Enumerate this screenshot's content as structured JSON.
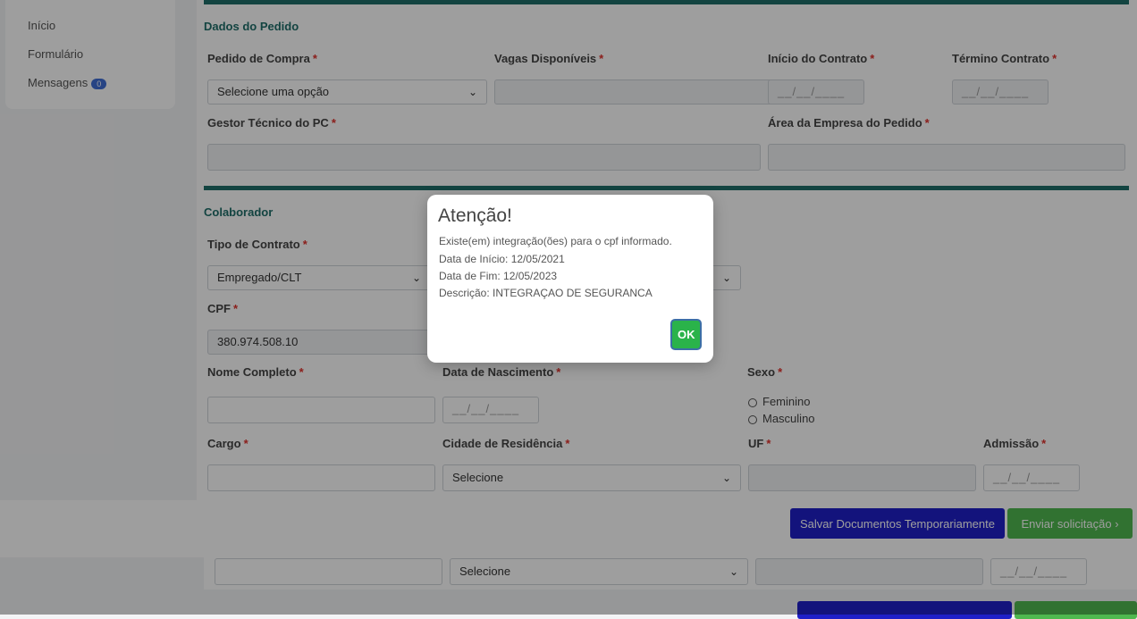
{
  "sidebar": {
    "items": [
      {
        "label": "Início"
      },
      {
        "label": "Formulário"
      },
      {
        "label": "Mensagens",
        "badge": "0"
      }
    ]
  },
  "pedido": {
    "section_title": "Dados do Pedido",
    "pedido_compra": {
      "label": "Pedido de Compra",
      "value": "Selecione uma opção"
    },
    "vagas": {
      "label": "Vagas Disponíveis",
      "value": ""
    },
    "inicio_contrato": {
      "label": "Início do Contrato",
      "placeholder": "__/__/____"
    },
    "termino_contrato": {
      "label": "Término Contrato",
      "placeholder": "__/__/____"
    },
    "gestor": {
      "label": "Gestor Técnico do PC",
      "value": ""
    },
    "area": {
      "label": "Área da Empresa do Pedido",
      "value": ""
    }
  },
  "colaborador": {
    "section_title": "Colaborador",
    "tipo_contrato": {
      "label": "Tipo de Contrato",
      "value": "Empregado/CLT"
    },
    "cpf": {
      "label": "CPF",
      "value": "380.974.508.10"
    },
    "nome": {
      "label": "Nome Completo",
      "value": ""
    },
    "nascimento": {
      "label": "Data de Nascimento",
      "placeholder": "__/__/____"
    },
    "sexo": {
      "label": "Sexo",
      "options": [
        "Feminino",
        "Masculino"
      ]
    },
    "cargo": {
      "label": "Cargo",
      "value": ""
    },
    "cidade": {
      "label": "Cidade de Residência",
      "value": "Selecione"
    },
    "uf": {
      "label": "UF",
      "value": ""
    },
    "admissao": {
      "label": "Admissão",
      "placeholder": "__/__/____"
    }
  },
  "footer": {
    "save_label": "Salvar Documentos Temporariamente",
    "send_label": "Enviar solicitação",
    "send_arrow": "›"
  },
  "strip": {
    "cidade": "Selecione",
    "admissao": "__/__/____"
  },
  "modal": {
    "title": "Atenção!",
    "lines": [
      "Existe(em) integração(ões) para o cpf informado.",
      "Data de Início: 12/05/2021",
      "Data de Fim: 12/05/2023",
      "Descrição: INTEGRAÇAO DE SEGURANCA"
    ],
    "ok_label": "OK"
  },
  "required_mark": "*",
  "colors": {
    "teal": "#1f6e6a",
    "save": "#1f1fc8",
    "send": "#4fb84f",
    "ok": "#2ab34a"
  }
}
